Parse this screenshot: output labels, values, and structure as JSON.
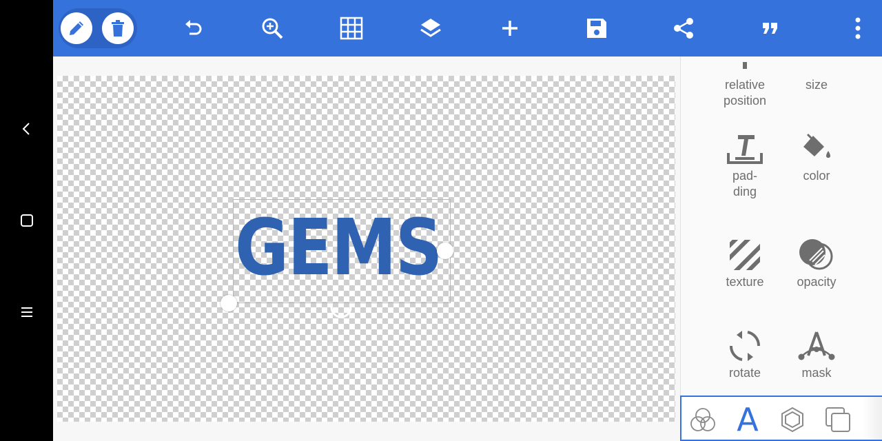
{
  "colors": {
    "toolbar": "#3572db",
    "toolbar_group": "#2d63c4",
    "text_color": "#2f62b0",
    "icon_grey": "#6e6e6e",
    "accent": "#3572db"
  },
  "system_nav": {
    "icons": [
      "back-icon",
      "home-icon",
      "menu-icon"
    ]
  },
  "toolbar": {
    "icons": [
      "edit-icon",
      "delete-icon",
      "undo-icon",
      "zoom-in-icon",
      "grid-icon",
      "layers-icon",
      "add-icon",
      "save-icon",
      "share-icon",
      "quote-icon",
      "more-vert-icon"
    ]
  },
  "canvas": {
    "text": "GEMS"
  },
  "panel": {
    "props": {
      "relative_position": "relative\nposition",
      "size": "size",
      "padding": "pad-\nding",
      "color": "color",
      "texture": "texture",
      "opacity": "opacity",
      "rotate": "rotate",
      "mask": "mask"
    }
  },
  "tabs": {
    "icons": [
      "blend-icon",
      "text-tab-icon",
      "shape-icon",
      "layers-tab-icon"
    ],
    "text_tab_label": "A",
    "active": "text-tab-icon"
  }
}
